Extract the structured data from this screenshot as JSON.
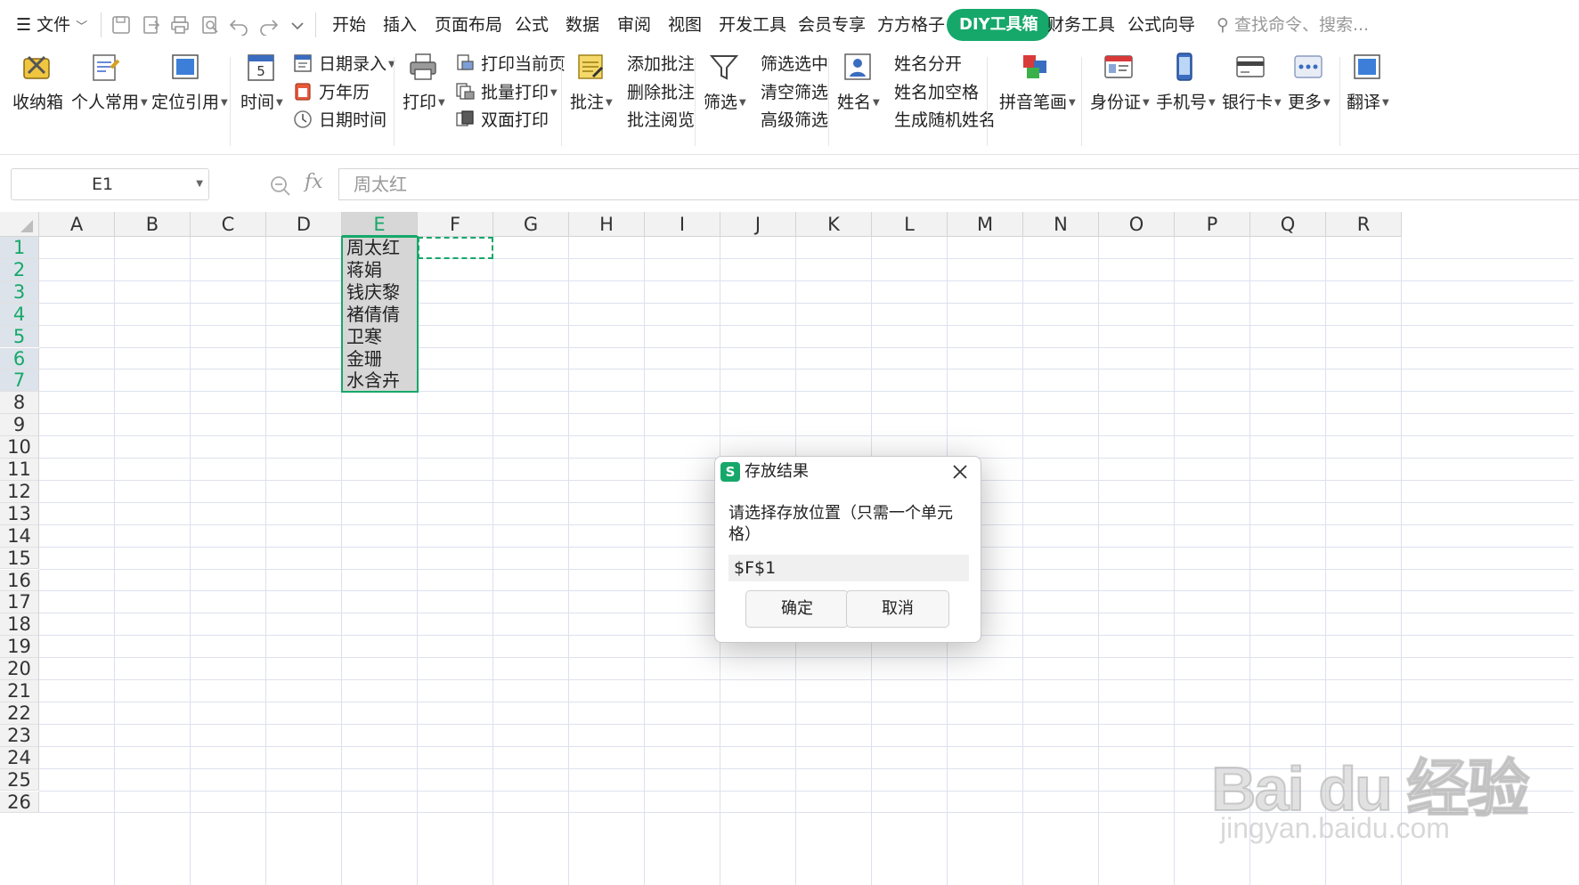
{
  "menubar": {
    "file_label": "文件",
    "tabs": [
      "开始",
      "插入",
      "页面布局",
      "公式",
      "数据",
      "审阅",
      "视图",
      "开发工具",
      "会员专享",
      "方方格子",
      "DIY工具箱",
      "财务工具",
      "公式向导"
    ],
    "active_tab": "DIY工具箱",
    "search_placeholder": "查找命令、搜索...",
    "accent_color": "#16a86a"
  },
  "ribbon": {
    "toolbox": "收纳箱",
    "personal": "个人常用",
    "locate_ref": "定位引用",
    "time": "时间",
    "date_entry": "日期录入",
    "calendar": "万年历",
    "date_time": "日期时间",
    "print": "打印",
    "print_current": "打印当前页",
    "batch_print": "批量打印",
    "duplex_print": "双面打印",
    "comment": "批注",
    "add_comment": "添加批注",
    "delete_comment": "删除批注",
    "browse_comment": "批注阅览",
    "filter": "筛选",
    "filter_selected": "筛选选中",
    "clear_filter": "清空筛选",
    "advanced_filter": "高级筛选",
    "name": "姓名",
    "split_name": "姓名分开",
    "name_add_space": "姓名加空格",
    "random_name": "生成随机姓名",
    "pinyin": "拼音笔画",
    "id_card": "身份证",
    "phone": "手机号",
    "bank_card": "银行卡",
    "more": "更多",
    "translate": "翻译"
  },
  "formula_bar": {
    "name_box": "E1",
    "fx_label": "fx",
    "formula": "周太红"
  },
  "sheet": {
    "columns": [
      "A",
      "B",
      "C",
      "D",
      "E",
      "F",
      "G",
      "H",
      "I",
      "J",
      "K",
      "L",
      "M",
      "N",
      "O",
      "P",
      "Q",
      "R"
    ],
    "rows": [
      "1",
      "2",
      "3",
      "4",
      "5",
      "6",
      "7",
      "8",
      "9",
      "10",
      "11",
      "12",
      "13",
      "14",
      "15",
      "16",
      "17",
      "18",
      "19",
      "20",
      "21",
      "22",
      "23",
      "24",
      "25",
      "26"
    ],
    "selected_column": "E",
    "column_e_values": [
      "周太红",
      "蒋娟",
      "钱庆黎",
      "褚倩倩",
      "卫寒",
      "金珊",
      "水含卉"
    ]
  },
  "dialog": {
    "title": "存放结果",
    "logo": "S",
    "prompt": "请选择存放位置（只需一个单元格）",
    "input_value": "$F$1",
    "ok_label": "确定",
    "cancel_label": "取消"
  },
  "watermark": {
    "brand": "Bai du 经验",
    "url": "jingyan.baidu.com"
  }
}
